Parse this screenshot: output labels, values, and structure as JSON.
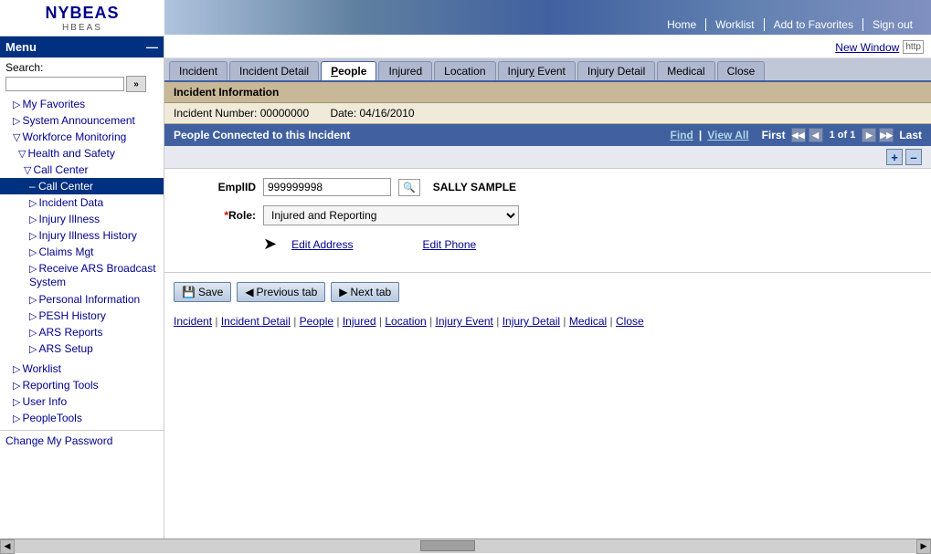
{
  "logo": {
    "text": "NYBEAS",
    "sub": "HBEAS"
  },
  "topnav": {
    "home": "Home",
    "worklist": "Worklist",
    "add_favorites": "Add to Favorites",
    "sign_out": "Sign out"
  },
  "sidebar": {
    "menu_label": "Menu",
    "minimize_icon": "—",
    "search_label": "Search:",
    "search_placeholder": "",
    "search_btn": "»",
    "items": [
      {
        "label": "My Favorites",
        "indent": 1,
        "prefix": "▷",
        "active": false
      },
      {
        "label": "System Announcement",
        "indent": 1,
        "prefix": "▷",
        "active": false
      },
      {
        "label": "Workforce Monitoring",
        "indent": 1,
        "prefix": "▽",
        "active": false
      },
      {
        "label": "Health and Safety",
        "indent": 2,
        "prefix": "▽",
        "active": false
      },
      {
        "label": "Call Center",
        "indent": 3,
        "prefix": "▽",
        "active": false
      },
      {
        "label": "– Call Center",
        "indent": 4,
        "prefix": "",
        "active": true
      },
      {
        "label": "Incident Data",
        "indent": 4,
        "prefix": "▷",
        "active": false
      },
      {
        "label": "Injury Illness",
        "indent": 4,
        "prefix": "▷",
        "active": false
      },
      {
        "label": "Injury Illness History",
        "indent": 4,
        "prefix": "▷",
        "active": false
      },
      {
        "label": "Claims Mgt",
        "indent": 4,
        "prefix": "▷",
        "active": false
      },
      {
        "label": "Receive ARS Broadcast System",
        "indent": 4,
        "prefix": "▷",
        "active": false
      },
      {
        "label": "Personal Information",
        "indent": 4,
        "prefix": "▷",
        "active": false
      },
      {
        "label": "PESH History",
        "indent": 4,
        "prefix": "▷",
        "active": false
      },
      {
        "label": "ARS Reports",
        "indent": 4,
        "prefix": "▷",
        "active": false
      },
      {
        "label": "ARS Setup",
        "indent": 4,
        "prefix": "▷",
        "active": false
      },
      {
        "label": "Worklist",
        "indent": 1,
        "prefix": "▷",
        "active": false
      },
      {
        "label": "Reporting Tools",
        "indent": 1,
        "prefix": "▷",
        "active": false
      },
      {
        "label": "User Info",
        "indent": 1,
        "prefix": "▷",
        "active": false
      },
      {
        "label": "PeopleTools",
        "indent": 1,
        "prefix": "▷",
        "active": false
      }
    ],
    "change_password": "Change My Password"
  },
  "content": {
    "new_window": "New Window",
    "tabs": [
      {
        "label": "Incident",
        "active": false
      },
      {
        "label": "Incident Detail",
        "active": false
      },
      {
        "label": "People",
        "active": true
      },
      {
        "label": "Injured",
        "active": false
      },
      {
        "label": "Location",
        "active": false
      },
      {
        "label": "Injury Event",
        "active": false
      },
      {
        "label": "Injury Detail",
        "active": false
      },
      {
        "label": "Medical",
        "active": false
      },
      {
        "label": "Close",
        "active": false
      }
    ],
    "incident_info_label": "Incident Information",
    "incident_number_label": "Incident Number:",
    "incident_number": "00000000",
    "date_label": "Date:",
    "date": "04/16/2010",
    "people_section_label": "People Connected to this Incident",
    "find_label": "Find",
    "view_all_label": "View All",
    "first_label": "First",
    "page_info": "1 of 1",
    "last_label": "Last",
    "empid_label": "EmplID",
    "empid_value": "999999998",
    "employee_name": "SALLY SAMPLE",
    "role_label": "*Role:",
    "role_value": "Injured and Reporting",
    "edit_address": "Edit Address",
    "edit_phone": "Edit Phone",
    "save_btn": "Save",
    "prev_tab_btn": "Previous tab",
    "next_tab_btn": "Next tab",
    "bottom_links": [
      "Incident",
      "Incident Detail",
      "People",
      "Injured",
      "Location",
      "Injury Event",
      "Injury Detail",
      "Medical",
      "Close"
    ]
  }
}
